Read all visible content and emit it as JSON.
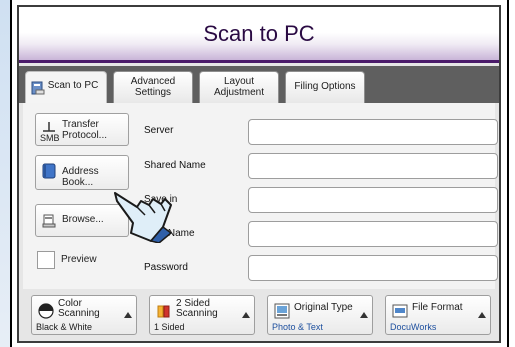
{
  "window": {
    "title": "Scan to PC"
  },
  "tabs": [
    {
      "label": "Scan to PC",
      "active": true
    },
    {
      "label": "Advanced Settings"
    },
    {
      "label": "Layout Adjustment"
    },
    {
      "label": "Filing Options"
    }
  ],
  "left_buttons": {
    "transfer_protocol": {
      "label": "Transfer Protocol...",
      "value": "SMB"
    },
    "address_book": {
      "label": "Address Book..."
    },
    "browse": {
      "label": "Browse..."
    },
    "preview": {
      "label": "Preview"
    }
  },
  "fields": [
    {
      "label": "Server",
      "value": ""
    },
    {
      "label": "Shared Name",
      "value": ""
    },
    {
      "label": "Save in",
      "value": ""
    },
    {
      "label": "User Name",
      "value": ""
    },
    {
      "label": "Password",
      "value": ""
    }
  ],
  "bottom_buttons": [
    {
      "label": "Color Scanning",
      "value": "Black & White"
    },
    {
      "label": "2 Sided Scanning",
      "value": "1 Sided"
    },
    {
      "label": "Original Type",
      "value": "Photo & Text"
    },
    {
      "label": "File Format",
      "value": "DocuWorks"
    }
  ],
  "colors": {
    "title_purple": "#4b1b6a",
    "tab_bar": "#5f5f5f",
    "value_blue": "#1d4f9e"
  }
}
